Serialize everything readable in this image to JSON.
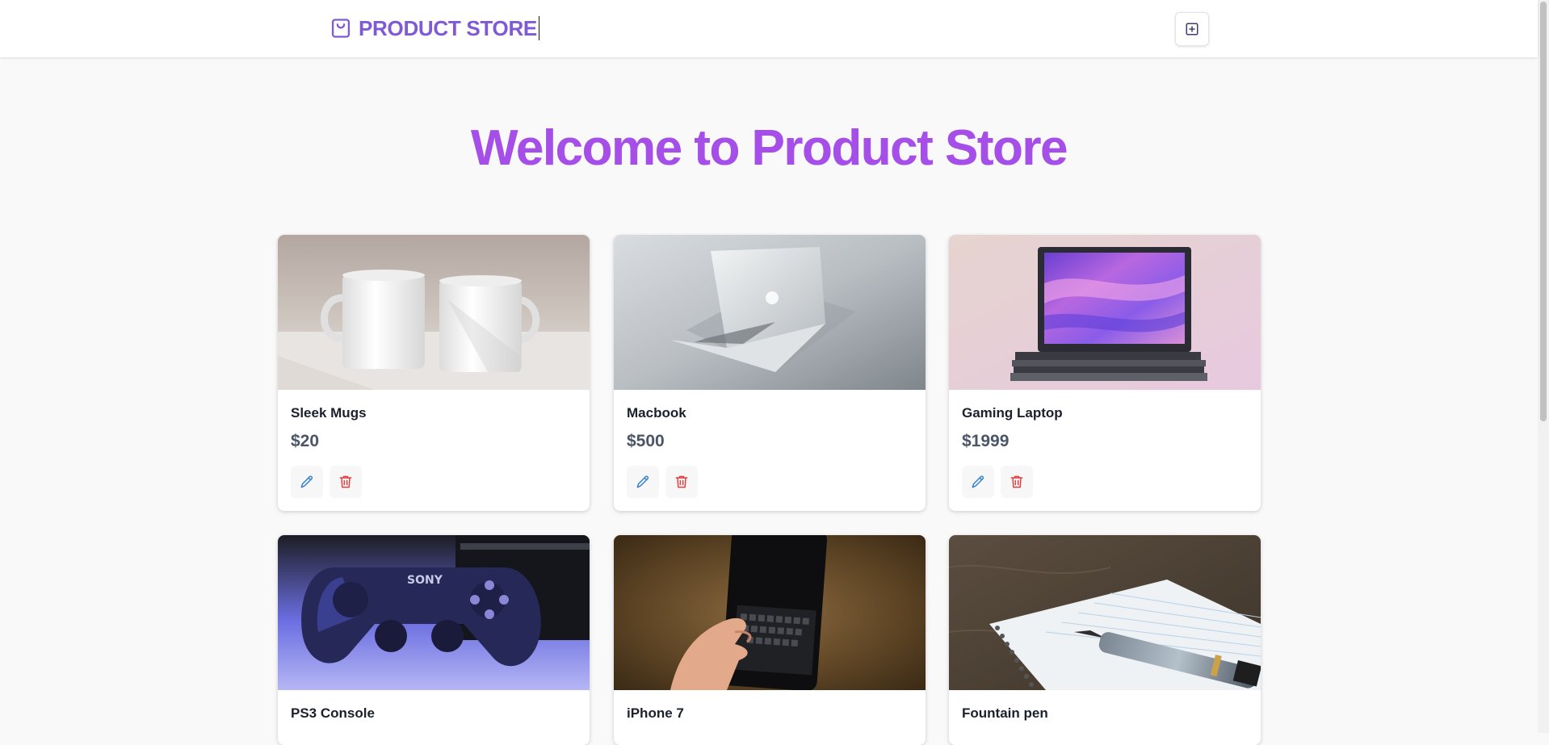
{
  "navbar": {
    "brand_label": "PRODUCT STORE",
    "brand_icon": "shopping-bag-icon",
    "add_icon": "plus-square-icon"
  },
  "hero": {
    "title": "Welcome to Product Store"
  },
  "colors": {
    "brand": "#805ad5",
    "hero": "#a64fe8",
    "edit": "#3182ce",
    "delete": "#e53e3e"
  },
  "products": [
    {
      "name": "Sleek Mugs",
      "price": "$20",
      "image": "two white mugs"
    },
    {
      "name": "Macbook",
      "price": "$500",
      "image": "silver laptop"
    },
    {
      "name": "Gaming Laptop",
      "price": "$1999",
      "image": "laptop with colorful screen"
    },
    {
      "name": "PS3 Console",
      "price": "",
      "image": "game controller"
    },
    {
      "name": "iPhone 7",
      "price": "",
      "image": "hand holding phone"
    },
    {
      "name": "Fountain pen",
      "price": "",
      "image": "pen on notebook"
    }
  ]
}
